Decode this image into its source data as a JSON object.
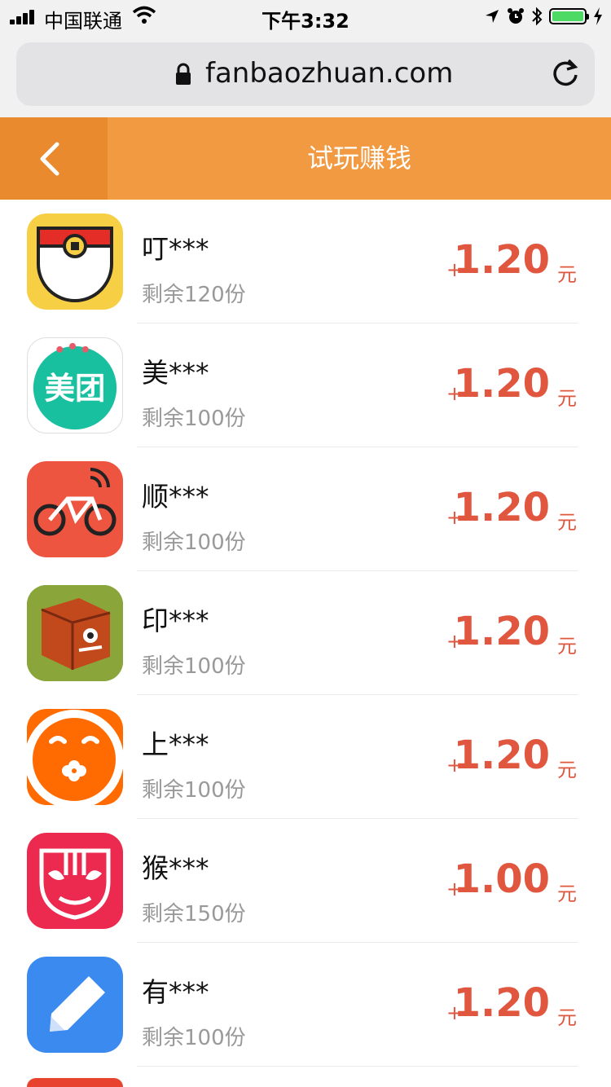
{
  "status": {
    "carrier": "中国联通",
    "time": "下午3:32"
  },
  "browser": {
    "url": "fanbaozhuan.com"
  },
  "header": {
    "title": "试玩赚钱"
  },
  "items": [
    {
      "name": "叮***",
      "remain": "剩余120份",
      "plus": "+",
      "reward": "1.20",
      "unit": "元",
      "icon": "coin-pouch-icon",
      "color": "#f7cf45"
    },
    {
      "name": "美***",
      "remain": "剩余100份",
      "plus": "+",
      "reward": "1.20",
      "unit": "元",
      "icon": "meituan-icon",
      "color": "#19c0a0",
      "icon_text": "美团"
    },
    {
      "name": "顺***",
      "remain": "剩余100份",
      "plus": "+",
      "reward": "1.20",
      "unit": "元",
      "icon": "bike-icon",
      "color": "#ee5540"
    },
    {
      "name": "印***",
      "remain": "剩余100份",
      "plus": "+",
      "reward": "1.20",
      "unit": "元",
      "icon": "monster-cube-icon",
      "color": "#6b8a2e"
    },
    {
      "name": "上***",
      "remain": "剩余100份",
      "plus": "+",
      "reward": "1.20",
      "unit": "元",
      "icon": "smiley-flower-icon",
      "color": "#ff6b00"
    },
    {
      "name": "猴***",
      "remain": "剩余150份",
      "plus": "+",
      "reward": "1.00",
      "unit": "元",
      "icon": "monkey-mask-icon",
      "color": "#ec2a4f"
    },
    {
      "name": "有***",
      "remain": "剩余100份",
      "plus": "+",
      "reward": "1.20",
      "unit": "元",
      "icon": "pencil-icon",
      "color": "#3b8af0"
    }
  ]
}
